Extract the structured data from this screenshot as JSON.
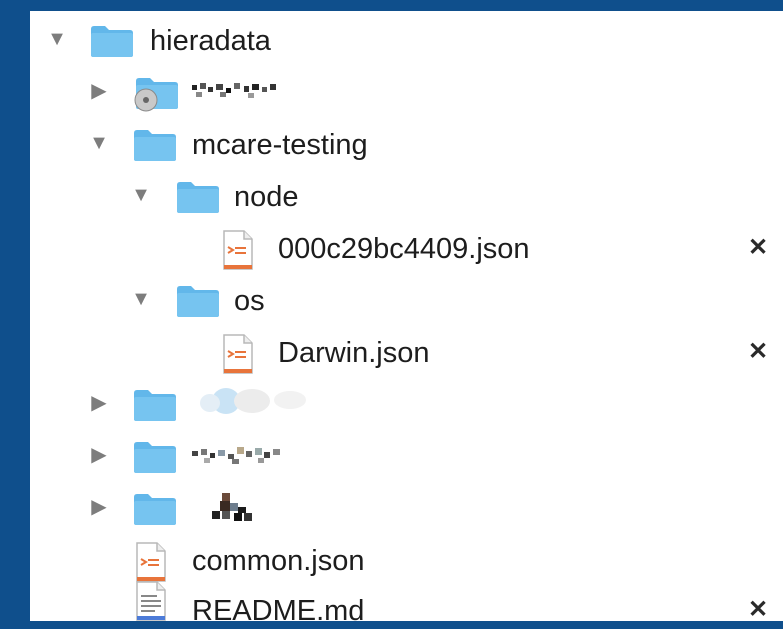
{
  "colors": {
    "window_background": "#0f4f8c",
    "folder_blue": "#62b7ea",
    "json_orange": "#e8743b",
    "markdown_blue": "#4c7bd8"
  },
  "tree": {
    "root": {
      "label": "hieradata",
      "expanded": true,
      "icon": "folder-icon"
    },
    "redacted_folder_1": {
      "label": "",
      "expanded": false,
      "icon": "disk-folder-icon"
    },
    "mcare_testing": {
      "label": "mcare-testing",
      "expanded": true,
      "icon": "folder-icon"
    },
    "node": {
      "label": "node",
      "expanded": true,
      "icon": "folder-icon"
    },
    "node_file": {
      "label": "000c29bc4409.json",
      "icon": "json-file-icon",
      "close": "✕"
    },
    "os": {
      "label": "os",
      "expanded": true,
      "icon": "folder-icon"
    },
    "os_file": {
      "label": "Darwin.json",
      "icon": "json-file-icon",
      "close": "✕"
    },
    "redacted_folder_2": {
      "label": "",
      "expanded": false,
      "icon": "folder-icon"
    },
    "redacted_folder_3": {
      "label": "",
      "expanded": false,
      "icon": "folder-icon"
    },
    "redacted_folder_4": {
      "label": "",
      "expanded": false,
      "icon": "folder-icon"
    },
    "common": {
      "label": "common.json",
      "icon": "json-file-icon"
    },
    "readme": {
      "label": "README.md",
      "icon": "markdown-file-icon",
      "close": "✕"
    }
  },
  "glyphs": {
    "expanded": "▼",
    "collapsed": "▶"
  }
}
